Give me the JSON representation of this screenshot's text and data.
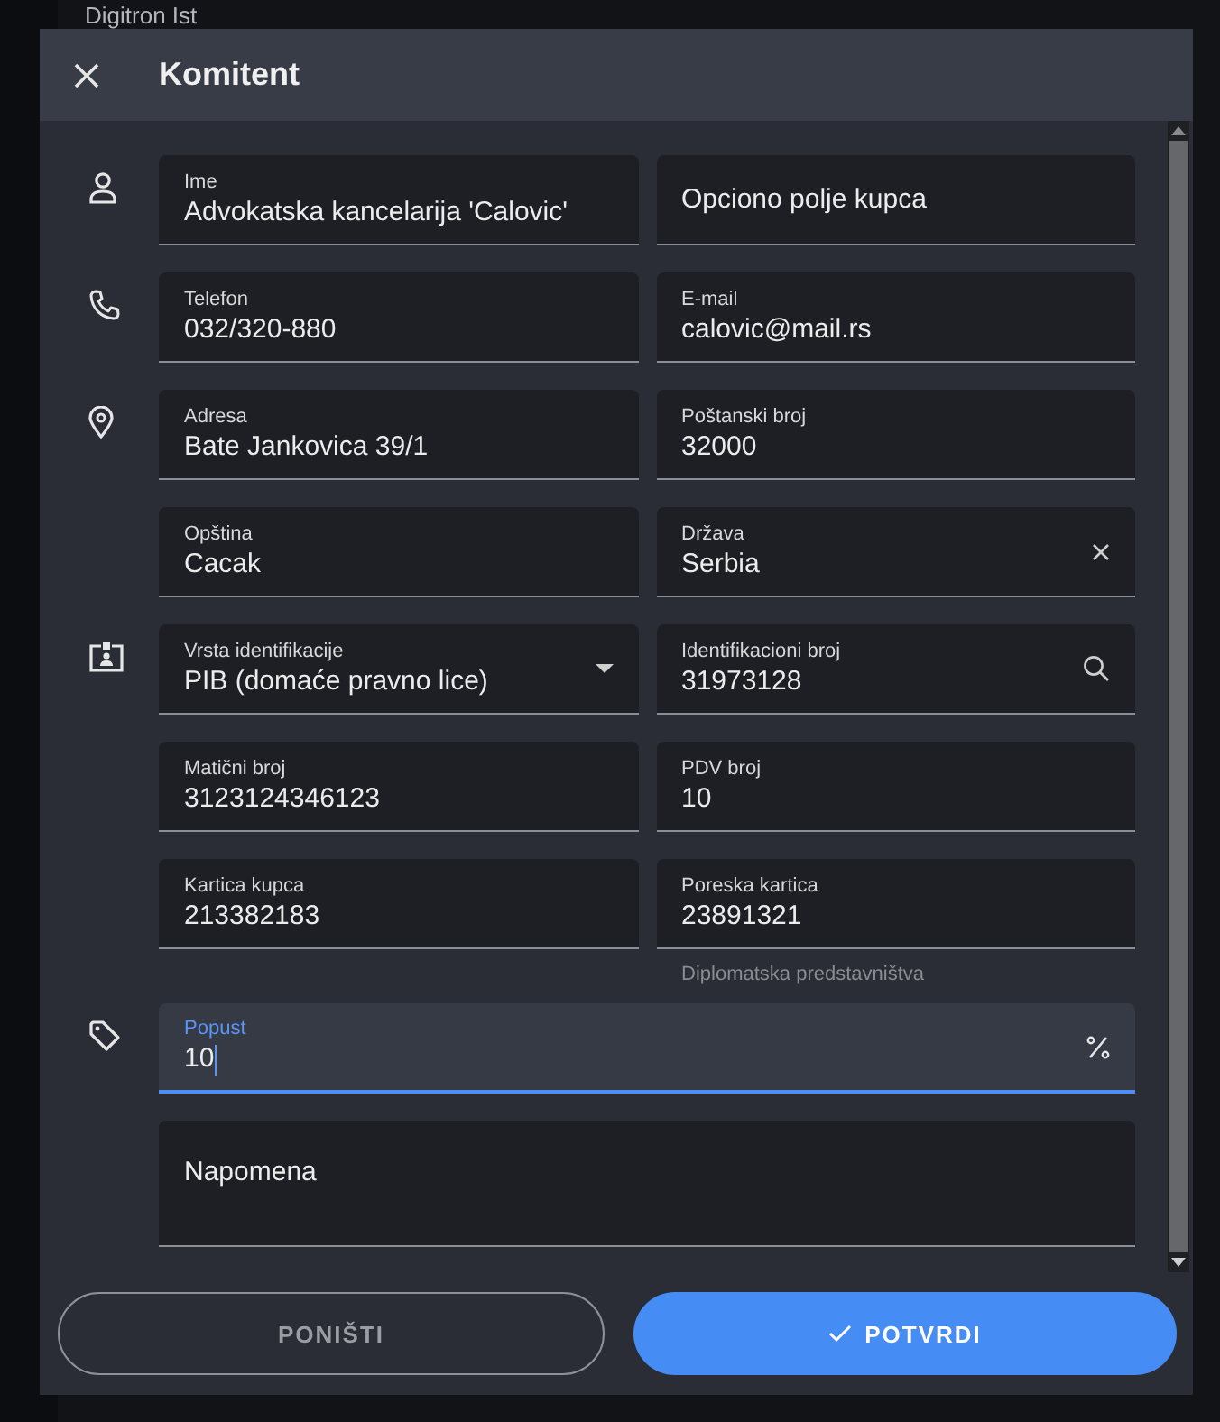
{
  "background": {
    "title": "Digitron Ist"
  },
  "dialog": {
    "title": "Komitent"
  },
  "rows": [
    {
      "kind": "person",
      "fields": [
        {
          "kind": "text",
          "label": "Ime",
          "value": "Advokatska kancelarija 'Calovic'",
          "focused": false
        },
        {
          "kind": "text",
          "placeholder": "Opciono polje kupca",
          "focused": false
        }
      ]
    },
    {
      "kind": "phone",
      "fields": [
        {
          "kind": "text",
          "label": "Telefon",
          "value": "032/320-880",
          "focused": false
        },
        {
          "kind": "text",
          "label": "E-mail",
          "value": "calovic@mail.rs",
          "focused": false
        }
      ]
    },
    {
      "kind": "pin",
      "fields": [
        {
          "kind": "text",
          "label": "Adresa",
          "value": "Bate Jankovica 39/1",
          "focused": false
        },
        {
          "kind": "text",
          "label": "Poštanski broj",
          "value": "32000",
          "focused": false
        }
      ]
    },
    {
      "fields": [
        {
          "kind": "text",
          "label": "Opština",
          "value": "Cacak",
          "focused": false
        },
        {
          "kind": "clearable",
          "label": "Država",
          "value": "Serbia",
          "focused": false
        }
      ]
    },
    {
      "kind": "badge",
      "fields": [
        {
          "kind": "select",
          "label": "Vrsta identifikacije",
          "value": "PIB (domaće pravno lice)",
          "focused": false
        },
        {
          "kind": "search",
          "label": "Identifikacioni broj",
          "value": "31973128",
          "focused": false
        }
      ]
    },
    {
      "fields": [
        {
          "kind": "text",
          "label": "Matični broj",
          "value": "3123124346123",
          "focused": false
        },
        {
          "kind": "text",
          "label": "PDV broj",
          "value": "10",
          "focused": false
        }
      ]
    },
    {
      "fields": [
        {
          "kind": "text",
          "label": "Kartica kupca",
          "value": "213382183",
          "focused": false
        },
        {
          "kind": "text",
          "label": "Poreska kartica",
          "value": "23891321",
          "helper": "Diplomatska predstavništva",
          "focused": false
        }
      ]
    },
    {
      "kind": "tag",
      "fields": [
        {
          "kind": "percent",
          "label": "Popust",
          "value": "10",
          "focused": true
        }
      ]
    },
    {
      "fields": [
        {
          "kind": "textarea",
          "placeholder": "Napomena",
          "focused": false
        }
      ]
    }
  ],
  "buttons": [
    {
      "label": "PONIŠTI",
      "kind": "outlined"
    },
    {
      "label": "POTVRDI",
      "kind": "primary"
    }
  ]
}
